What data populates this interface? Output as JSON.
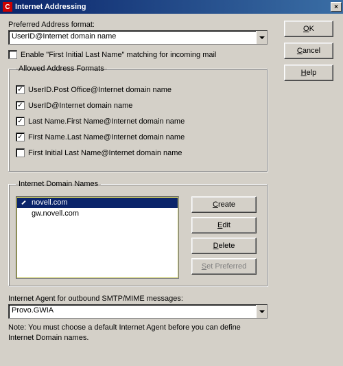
{
  "title": "Internet Addressing",
  "buttons": {
    "ok": "OK",
    "ok_ul": "O",
    "cancel": "Cancel",
    "cancel_ul": "C",
    "help": "Help",
    "help_ul": "H",
    "close": "×"
  },
  "pref": {
    "label": "Preferred Address format:",
    "value": "UserID@Internet domain name"
  },
  "enable_match": {
    "label": "Enable \"First Initial Last Name\" matching for incoming mail",
    "checked": false
  },
  "formats": {
    "legend": "Allowed Address Formats",
    "items": [
      {
        "label": "UserID.Post Office@Internet domain name",
        "checked": true
      },
      {
        "label": "UserID@Internet domain name",
        "checked": true
      },
      {
        "label": "Last Name.First Name@Internet domain name",
        "checked": true
      },
      {
        "label": "First Name.Last Name@Internet domain name",
        "checked": true
      },
      {
        "label": "First Initial Last Name@Internet domain name",
        "checked": false
      }
    ]
  },
  "domains": {
    "legend": "Internet Domain Names",
    "items": [
      {
        "label": "novell.com",
        "selected": true,
        "preferred": true
      },
      {
        "label": "gw.novell.com",
        "selected": false,
        "preferred": false
      }
    ],
    "btn_create": "Create",
    "btn_create_ul": "C",
    "btn_edit": "Edit",
    "btn_edit_ul": "E",
    "btn_delete": "Delete",
    "btn_delete_ul": "D",
    "btn_setpref": "Set Preferred",
    "btn_setpref_ul": "S"
  },
  "agent": {
    "label": "Internet Agent for outbound SMTP/MIME messages:",
    "value": "Provo.GWIA"
  },
  "note": "Note:  You must choose a default Internet Agent before you can define Internet Domain names."
}
